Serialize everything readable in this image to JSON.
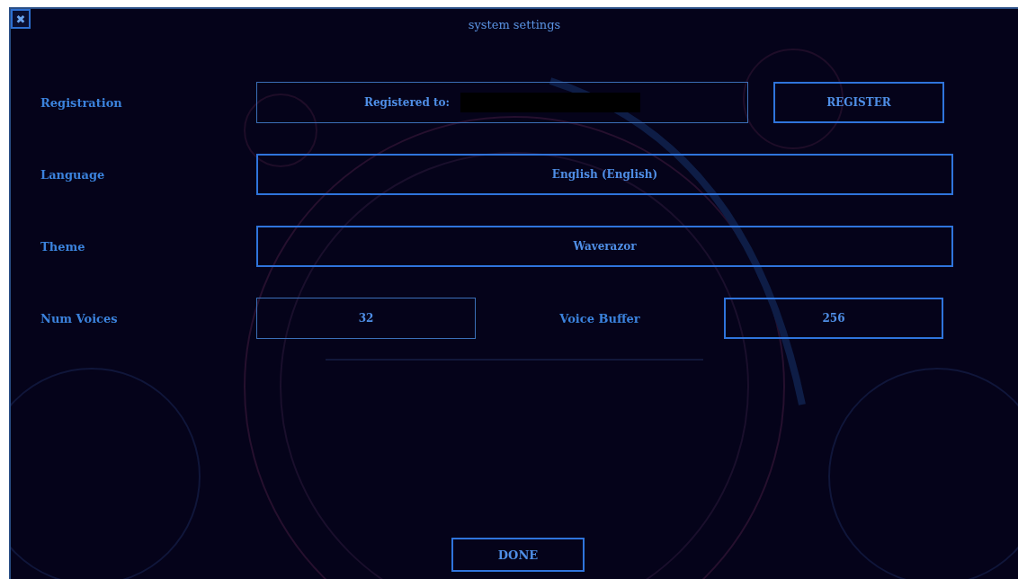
{
  "window": {
    "title": "system settings",
    "close": "✖"
  },
  "registration": {
    "label": "Registration",
    "text": "Registered to:",
    "button": "REGISTER"
  },
  "language": {
    "label": "Language",
    "value": "English (English)"
  },
  "theme": {
    "label": "Theme",
    "value": "Waverazor"
  },
  "voices": {
    "label": "Num Voices",
    "value": "32"
  },
  "buffer": {
    "label": "Voice Buffer",
    "value": "256"
  },
  "done": "DONE"
}
